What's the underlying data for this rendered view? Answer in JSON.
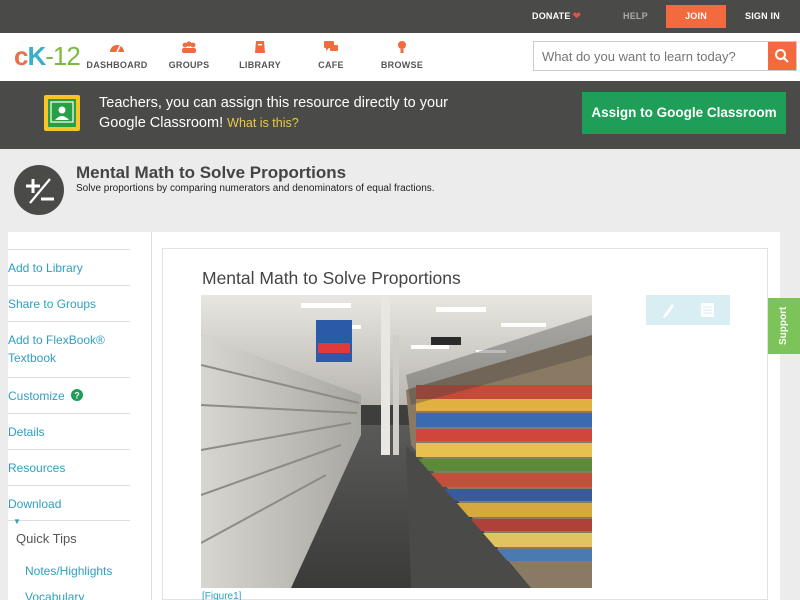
{
  "topbar": {
    "donate": "DONATE",
    "help": "HELP",
    "join": "JOIN",
    "signin": "SIGN IN"
  },
  "logo": {
    "c": "c",
    "k": "K",
    "n": "-12"
  },
  "nav": [
    {
      "label": "DASHBOARD",
      "icon": "dashboard-icon"
    },
    {
      "label": "GROUPS",
      "icon": "groups-icon"
    },
    {
      "label": "LIBRARY",
      "icon": "library-icon"
    },
    {
      "label": "CAFE",
      "icon": "cafe-icon"
    },
    {
      "label": "BROWSE",
      "icon": "browse-icon"
    }
  ],
  "search": {
    "placeholder": "What do you want to learn today?"
  },
  "banner": {
    "text": "Teachers, you can assign this resource directly to your Google Classroom!",
    "what": "What is this?",
    "assign": "Assign to Google Classroom"
  },
  "header": {
    "title": "Mental Math to Solve Proportions",
    "subtitle": "Solve proportions by comparing numerators and denominators of equal fractions."
  },
  "sidebar": {
    "items": [
      "Add to Library",
      "Share to Groups",
      "Add to FlexBook® Textbook",
      "Customize",
      "Details",
      "Resources",
      "Download"
    ],
    "quick_tips": "Quick Tips",
    "qt_items": [
      "Notes/Highlights",
      "Vocabulary"
    ]
  },
  "content": {
    "title": "Mental Math to Solve Proportions",
    "caption": "[Figure1]"
  },
  "support": "Support",
  "colors": {
    "dark": "#4a4a48",
    "orange": "#f26a3d",
    "green": "#1f9e58",
    "link": "#2f9fc0"
  }
}
